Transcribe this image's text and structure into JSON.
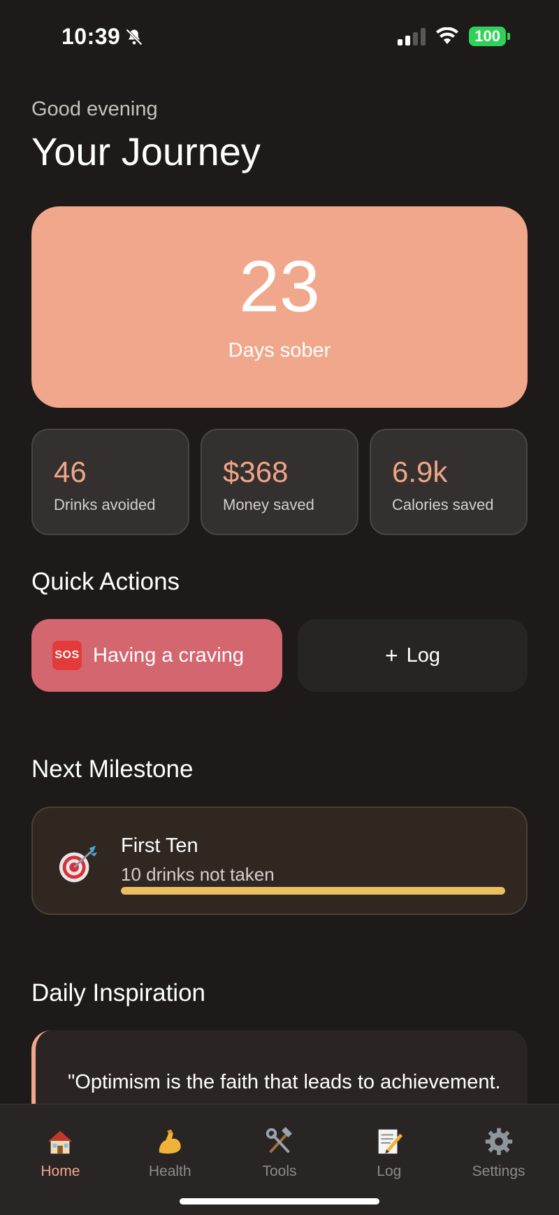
{
  "status_bar": {
    "time": "10:39",
    "battery": "100"
  },
  "header": {
    "greeting": "Good evening",
    "title": "Your Journey"
  },
  "hero": {
    "value": "23",
    "label": "Days sober",
    "color": "#f1a78b"
  },
  "stats": [
    {
      "value": "46",
      "label": "Drinks avoided"
    },
    {
      "value": "$368",
      "label": "Money saved"
    },
    {
      "value": "6.9k",
      "label": "Calories saved"
    }
  ],
  "quick_actions": {
    "title": "Quick Actions",
    "craving_label": "Having a craving",
    "craving_icon": "SOS",
    "log_label": "Log"
  },
  "milestone": {
    "section_title": "Next Milestone",
    "title": "First Ten",
    "subtitle": "10 drinks not taken",
    "progress": 1.0
  },
  "inspiration": {
    "section_title": "Daily Inspiration",
    "quote": "\"Optimism is the faith that leads to achievement. Nothing can be done without hope and confidence.\""
  },
  "tabs": [
    {
      "label": "Home",
      "icon": "house-icon",
      "active": true
    },
    {
      "label": "Health",
      "icon": "flexed-bicep-icon",
      "active": false
    },
    {
      "label": "Tools",
      "icon": "hammer-wrench-icon",
      "active": false
    },
    {
      "label": "Log",
      "icon": "memo-icon",
      "active": false
    },
    {
      "label": "Settings",
      "icon": "gear-icon",
      "active": false
    }
  ]
}
